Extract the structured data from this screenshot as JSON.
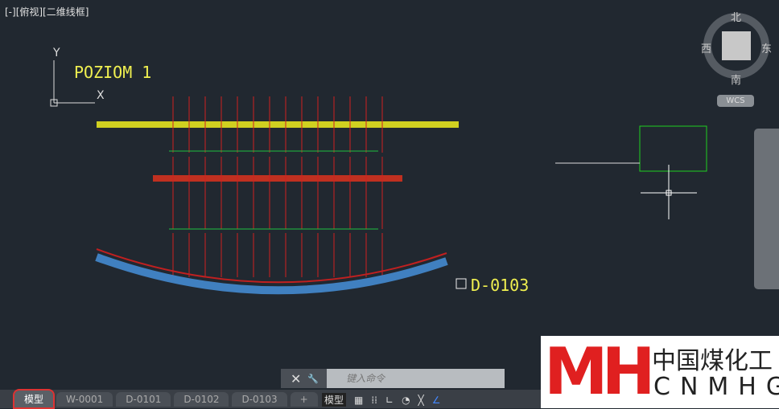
{
  "viewport": {
    "label": "[-][俯视][二维线框]"
  },
  "drawing": {
    "title1": "POZIOM 1",
    "title2": "D-0103",
    "ucs_x": "X",
    "ucs_y": "Y"
  },
  "viewcube": {
    "north": "北",
    "south": "南",
    "east": "东",
    "west": "西",
    "wcs": "WCS"
  },
  "command": {
    "placeholder": "键入命令",
    "close": "✕",
    "settings": "🔧"
  },
  "tabs": [
    {
      "label": "模型"
    },
    {
      "label": "W-0001"
    },
    {
      "label": "D-0101"
    },
    {
      "label": "D-0102"
    },
    {
      "label": "D-0103"
    },
    {
      "label": "+"
    }
  ],
  "status": {
    "model": "模型"
  },
  "watermark": {
    "letters": "MH",
    "cn": "中国煤化工",
    "en": "CNMHG"
  }
}
